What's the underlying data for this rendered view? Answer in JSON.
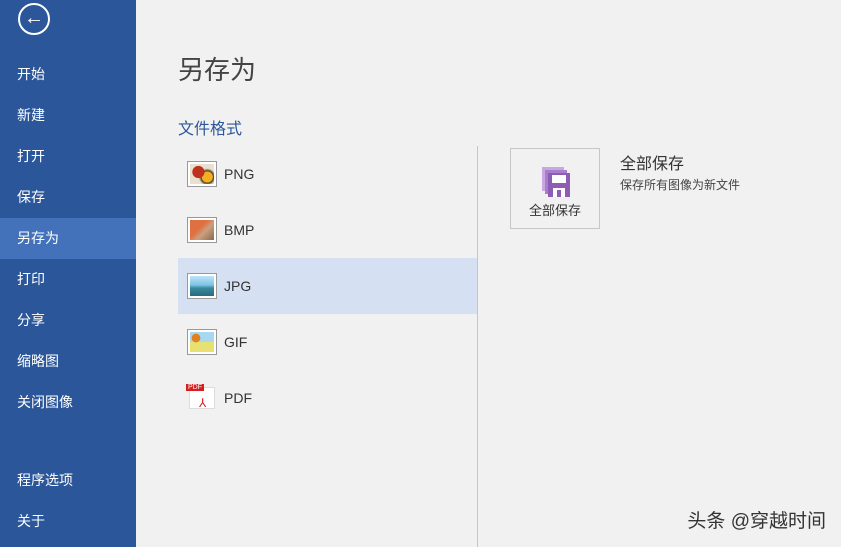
{
  "sidebar": {
    "back": "←",
    "items": [
      "开始",
      "新建",
      "打开",
      "保存",
      "另存为",
      "打印",
      "分享",
      "缩略图",
      "关闭图像"
    ],
    "bottom": [
      "程序选项",
      "关于"
    ],
    "selected": "另存为"
  },
  "main": {
    "title": "另存为",
    "section": "文件格式",
    "formats": [
      {
        "label": "PNG",
        "icon": "png-image-icon"
      },
      {
        "label": "BMP",
        "icon": "bmp-image-icon"
      },
      {
        "label": "JPG",
        "icon": "jpg-image-icon"
      },
      {
        "label": "GIF",
        "icon": "gif-image-icon"
      },
      {
        "label": "PDF",
        "icon": "pdf-icon"
      }
    ],
    "selected": "JPG",
    "save_all": {
      "button_label": "全部保存",
      "title": "全部保存",
      "description": "保存所有图像为新文件"
    }
  },
  "watermark": "头条 @穿越时间",
  "colors": {
    "sidebar": "#2b579a",
    "selected_nav": "#4372bb",
    "selected_row": "#d5e1f2",
    "accent": "#8e5bb5"
  }
}
